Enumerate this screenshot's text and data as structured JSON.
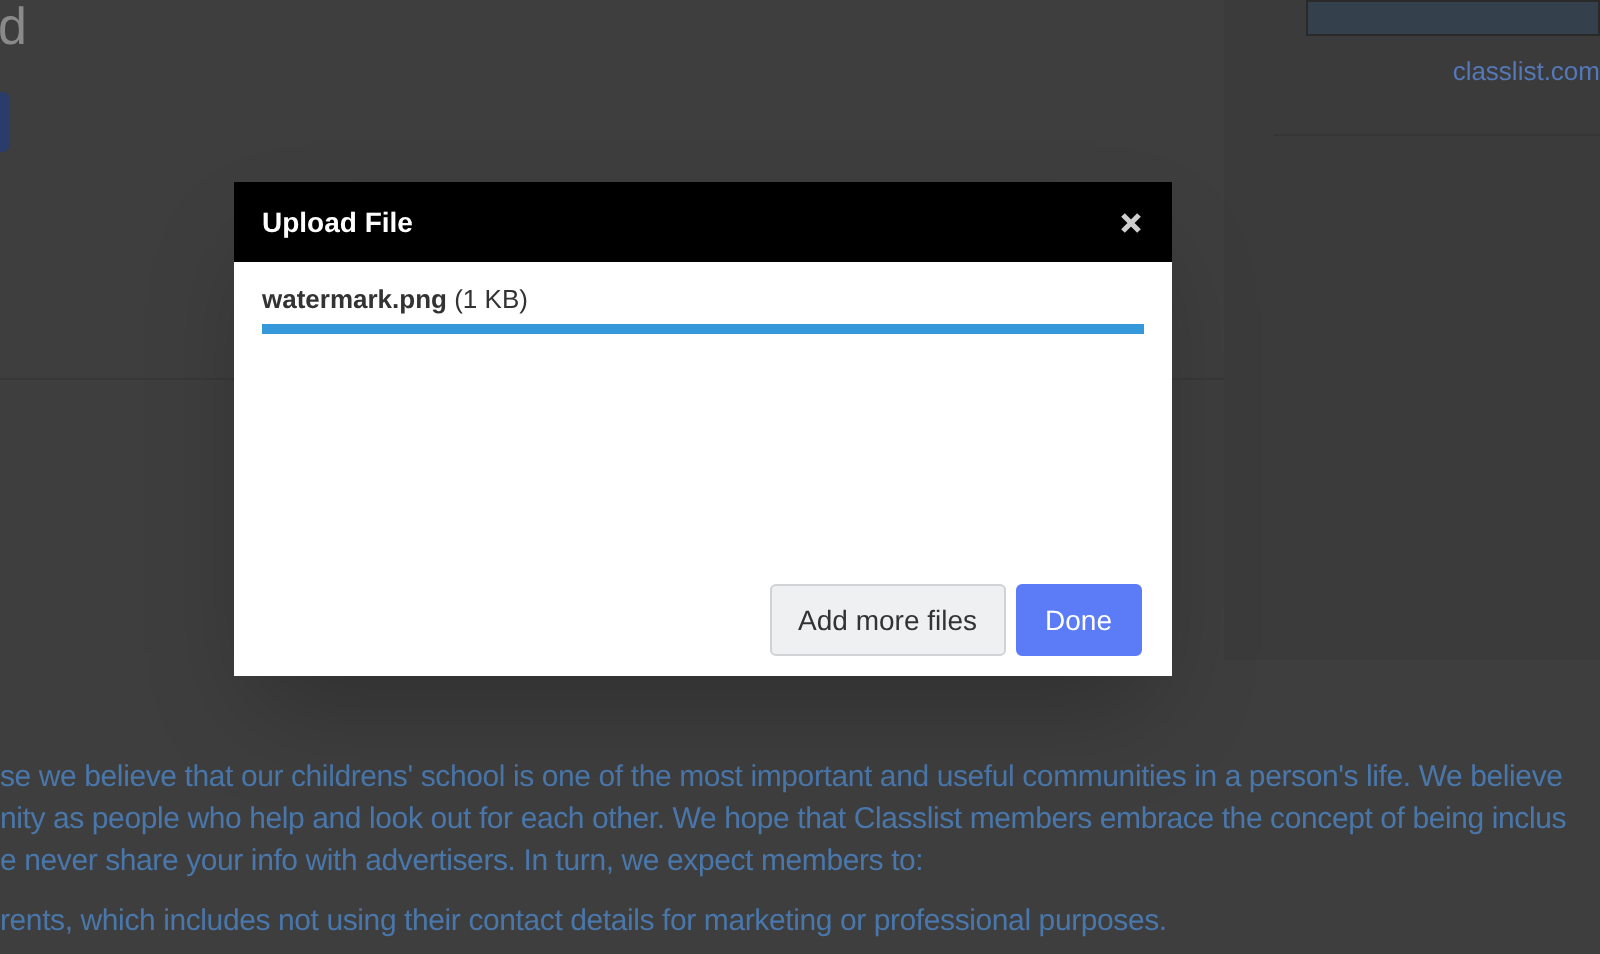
{
  "background_page": {
    "heading": "d",
    "sidebar_link": "classlist.com",
    "paragraph_lines": [
      "se we believe that our childrens' school is one of the most important and useful communities in a person's life. We believe",
      "nity as people who help and look out for each other. We hope that Classlist members embrace the concept of being inclus",
      "e never share your info with advertisers. In turn, we expect members to:"
    ],
    "list_line": "rents, which includes not using their contact details for marketing or professional purposes."
  },
  "dialog": {
    "title": "Upload File",
    "files": [
      {
        "label": "**watermark.png** (1 KB)",
        "level": 1
      }
    ],
    "buttons": [
      {
        "label": "Add more files",
        "kind": "secondary"
      },
      {
        "label": "Done",
        "kind": "primary"
      }
    ]
  }
}
